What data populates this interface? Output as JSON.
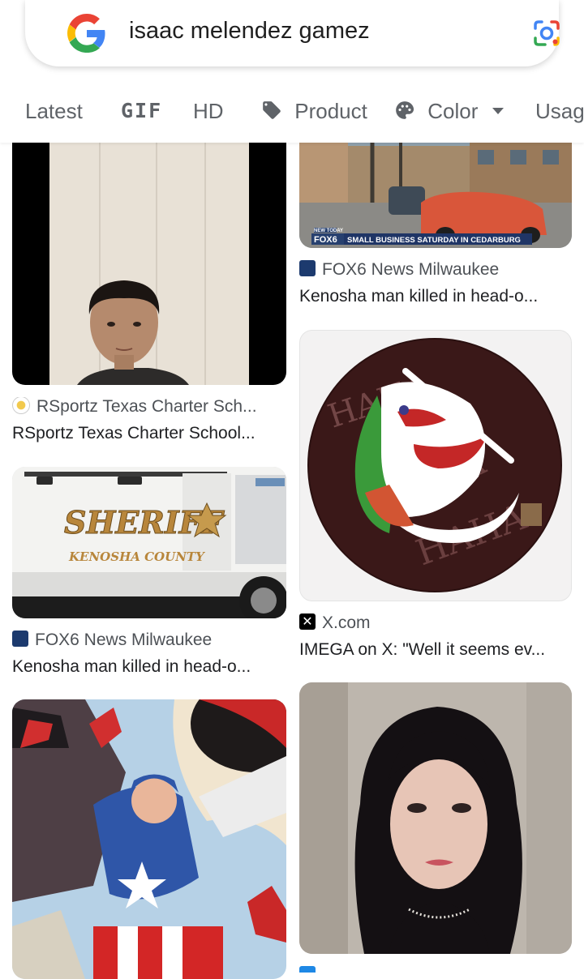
{
  "search": {
    "query": "isaac melendez gamez"
  },
  "filters": [
    {
      "label": "Latest"
    },
    {
      "label": "GIF"
    },
    {
      "label": "HD"
    },
    {
      "label": "Product"
    },
    {
      "label": "Color"
    },
    {
      "label": "Usag"
    }
  ],
  "left_column": [
    {
      "source": "RSportz Texas Charter Sch...",
      "title": "RSportz Texas Charter School..."
    },
    {
      "source": "FOX6 News Milwaukee",
      "title": "Kenosha man killed in head-o...",
      "image_text": {
        "main": "SHERIFF",
        "sub": "KENOSHA COUNTY"
      }
    },
    {}
  ],
  "right_column": [
    {
      "source": "FOX6 News Milwaukee",
      "title": "Kenosha man killed in head-o...",
      "image_text": {
        "logo": "FOX6",
        "tag": "NEW TODAY",
        "banner": "SMALL BUSINESS SATURDAY IN CEDARBURG"
      }
    },
    {
      "source": "X.com",
      "title": "IMEGA on X: \"Well it seems ev...",
      "image_text": {
        "ha": "HAHA"
      }
    },
    {}
  ],
  "icons": {
    "google_logo": "google-g-icon",
    "lens": "google-lens-icon",
    "product": "tag-icon",
    "color": "palette-icon"
  },
  "colors": {
    "google_blue": "#4285F4",
    "google_red": "#EA4335",
    "google_yellow": "#FBBC05",
    "google_green": "#34A853",
    "chip_text": "#5f6368"
  }
}
